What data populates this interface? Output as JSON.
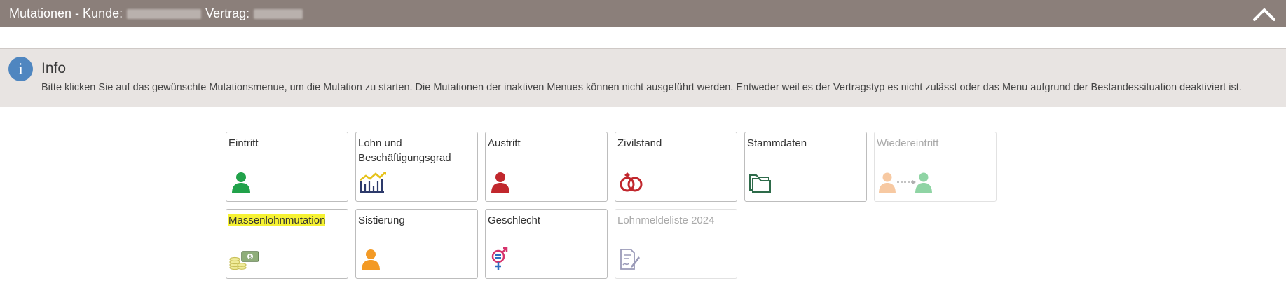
{
  "header": {
    "kunde_label": "Mutationen - Kunde:",
    "vertrag_label": "Vertrag:"
  },
  "info": {
    "title": "Info",
    "text": "Bitte klicken Sie auf das gewünschte Mutationsmenue, um die Mutation zu starten. Die Mutationen der inaktiven Menues können nicht ausgeführt werden. Entweder weil es der Vertragstyp es nicht zulässt oder das Menu aufgrund der Bestandessituation deaktiviert ist."
  },
  "tiles": [
    {
      "label": "Eintritt",
      "icon": "person-green-icon",
      "enabled": true
    },
    {
      "label": "Lohn und Beschäftigungsgrad",
      "icon": "chart-growth-icon",
      "enabled": true
    },
    {
      "label": "Austritt",
      "icon": "person-red-icon",
      "enabled": true
    },
    {
      "label": "Zivilstand",
      "icon": "rings-icon",
      "enabled": true
    },
    {
      "label": "Stammdaten",
      "icon": "folder-icon",
      "enabled": true
    },
    {
      "label": "Wiedereintritt",
      "icon": "person-transfer-icon",
      "enabled": false
    },
    {
      "label": "Massenlohnmutation",
      "icon": "money-coins-icon",
      "enabled": true,
      "highlighted": true
    },
    {
      "label": "Sistierung",
      "icon": "person-orange-icon",
      "enabled": true
    },
    {
      "label": "Geschlecht",
      "icon": "gender-icon",
      "enabled": true
    },
    {
      "label": "Lohnmeldeliste 2024",
      "icon": "document-sign-icon",
      "enabled": false
    }
  ],
  "colors": {
    "header_bg": "#8b7f7a",
    "info_bg": "#e8e4e2",
    "info_icon": "#4f86c0",
    "highlight": "#f6f233"
  }
}
